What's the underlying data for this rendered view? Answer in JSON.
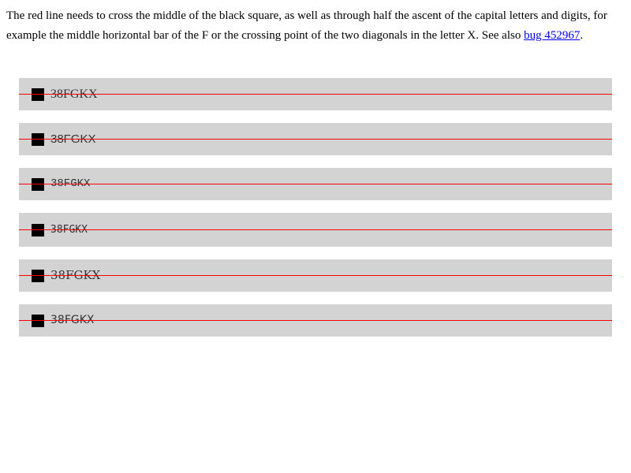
{
  "intro": {
    "text": "The red line needs to cross the middle of the black square, as well as through half the ascent of the capital letters and digits, for example the middle horizontal bar of the F or the crossing point of the two diagonals in the letter X. See also ",
    "link_text": "bug 452967",
    "end_text": "."
  },
  "rows": [
    {
      "sample": "38FGKX"
    },
    {
      "sample": "38FGKX"
    },
    {
      "sample": "38FGKX"
    },
    {
      "sample": "38FGKX"
    },
    {
      "sample": "38FGKX"
    },
    {
      "sample": "38FGKX"
    }
  ],
  "colors": {
    "row_background": "#d3d3d3",
    "line": "#ff0000",
    "square": "#000000",
    "link": "#0000ee"
  }
}
